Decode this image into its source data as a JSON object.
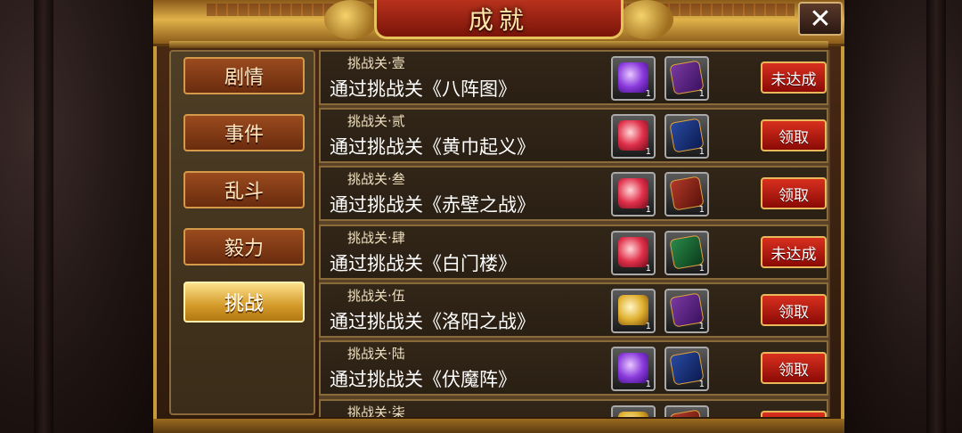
{
  "window": {
    "title": "成就",
    "close_label": "✕"
  },
  "sidebar": {
    "tabs": [
      {
        "label": "剧情",
        "active": false
      },
      {
        "label": "事件",
        "active": false
      },
      {
        "label": "乱斗",
        "active": false
      },
      {
        "label": "毅力",
        "active": false
      },
      {
        "label": "挑战",
        "active": true
      }
    ]
  },
  "achievements": [
    {
      "label": "挑战关·壹",
      "title": "通过挑战关《八阵图》",
      "rewards": [
        {
          "icon": "purple-gem",
          "count": "1"
        },
        {
          "icon": "purple-book",
          "count": "1"
        }
      ],
      "action": "未达成"
    },
    {
      "label": "挑战关·贰",
      "title": "通过挑战关《黄巾起义》",
      "rewards": [
        {
          "icon": "red-gem",
          "count": "1"
        },
        {
          "icon": "blue-book",
          "count": "1"
        }
      ],
      "action": "领取"
    },
    {
      "label": "挑战关·叁",
      "title": "通过挑战关《赤壁之战》",
      "rewards": [
        {
          "icon": "red-gem",
          "count": "1"
        },
        {
          "icon": "red-book",
          "count": "1"
        }
      ],
      "action": "领取"
    },
    {
      "label": "挑战关·肆",
      "title": "通过挑战关《白门楼》",
      "rewards": [
        {
          "icon": "red-gem",
          "count": "1"
        },
        {
          "icon": "green-book",
          "count": "1"
        }
      ],
      "action": "未达成"
    },
    {
      "label": "挑战关·伍",
      "title": "通过挑战关《洛阳之战》",
      "rewards": [
        {
          "icon": "gold-gem",
          "count": "1"
        },
        {
          "icon": "purple-book",
          "count": "1"
        }
      ],
      "action": "领取"
    },
    {
      "label": "挑战关·陆",
      "title": "通过挑战关《伏魔阵》",
      "rewards": [
        {
          "icon": "purple-gem",
          "count": "1"
        },
        {
          "icon": "blue-book",
          "count": "1"
        }
      ],
      "action": "领取"
    },
    {
      "label": "挑战关·柒",
      "title": "",
      "rewards": [
        {
          "icon": "gold-gem",
          "count": ""
        },
        {
          "icon": "red-book",
          "count": ""
        }
      ],
      "action": ""
    }
  ]
}
